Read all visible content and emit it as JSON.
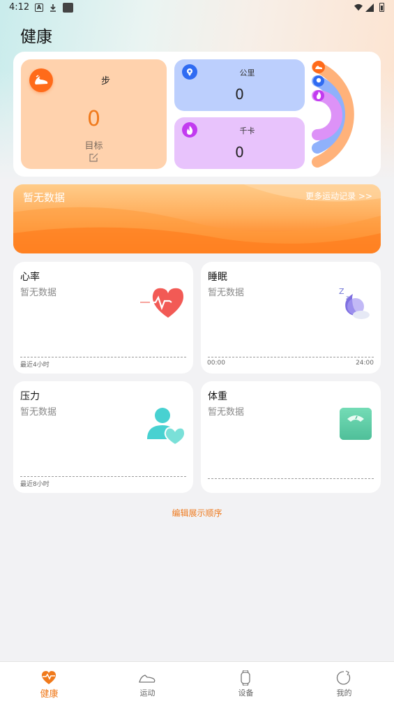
{
  "status_bar": {
    "time": "4:12",
    "icons": [
      "a-notification-icon",
      "download-icon",
      "app-notification-icon",
      "wifi-icon",
      "signal-icon",
      "battery-icon"
    ]
  },
  "header": {
    "title": "健康"
  },
  "summary": {
    "steps": {
      "label": "步",
      "value": "0",
      "goal_label": "目标",
      "icon": "running-shoe-icon"
    },
    "distance": {
      "label": "公里",
      "value": "0",
      "icon": "location-pin-icon"
    },
    "calories": {
      "label": "千卡",
      "value": "0",
      "icon": "flame-icon"
    },
    "rings": {
      "steps_progress": 1.0,
      "distance_progress": 1.0,
      "calories_progress": 1.0
    }
  },
  "exercise_banner": {
    "title": "暂无数据",
    "more_link": "更多运动记录 >>"
  },
  "cards": {
    "heart_rate": {
      "title": "心率",
      "status": "暂无数据",
      "axis_left": "最近4小时"
    },
    "sleep": {
      "title": "睡眠",
      "status": "暂无数据",
      "axis_left": "00:00",
      "axis_right": "24:00"
    },
    "stress": {
      "title": "压力",
      "status": "暂无数据",
      "axis_left": "最近8小时"
    },
    "weight": {
      "title": "体重",
      "status": "暂无数据"
    }
  },
  "edit_order": "编辑展示顺序",
  "bottom_nav": {
    "items": [
      {
        "label": "健康",
        "icon": "heart-pulse-icon",
        "active": true
      },
      {
        "label": "运动",
        "icon": "shoe-icon",
        "active": false
      },
      {
        "label": "设备",
        "icon": "watch-icon",
        "active": false
      },
      {
        "label": "我的",
        "icon": "profile-icon",
        "active": false
      }
    ]
  },
  "colors": {
    "accent": "#f07a1c",
    "steps": "#ff6b1a",
    "distance": "#2f6bf2",
    "calories": "#c23bf0"
  }
}
